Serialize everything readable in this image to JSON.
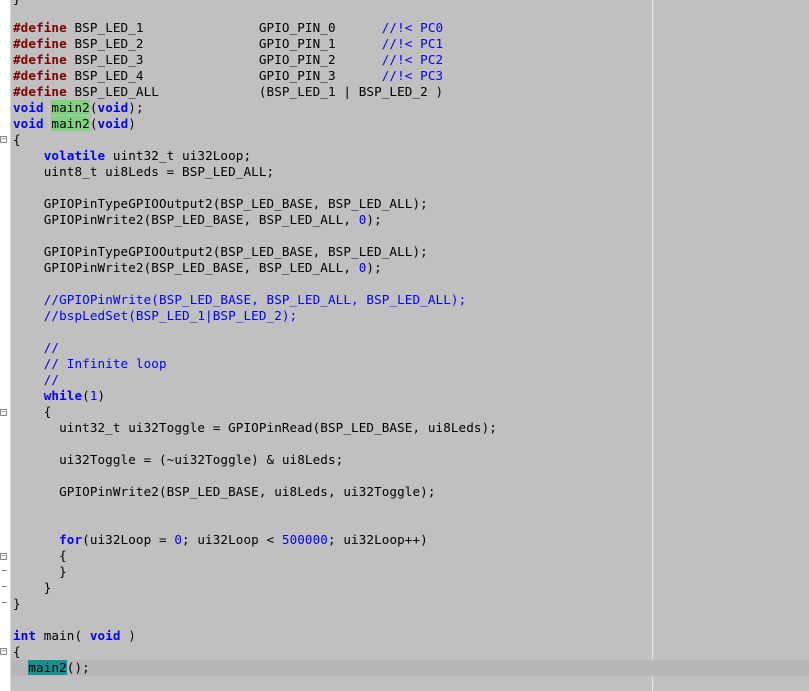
{
  "editor": {
    "top_fragment": "}",
    "lines": {
      "l1": {
        "t1": "#define",
        "t2": " BSP_LED_1               GPIO_PIN_0      ",
        "t3": "//!< PC0"
      },
      "l2": {
        "t1": "#define",
        "t2": " BSP_LED_2               GPIO_PIN_1      ",
        "t3": "//!< PC1"
      },
      "l3": {
        "t1": "#define",
        "t2": " BSP_LED_3               GPIO_PIN_2      ",
        "t3": "//!< PC2"
      },
      "l4": {
        "t1": "#define",
        "t2": " BSP_LED_4               GPIO_PIN_3      ",
        "t3": "//!< PC3"
      },
      "l5": {
        "t1": "#define",
        "t2": " BSP_LED_ALL             (BSP_LED_1 | BSP_LED_2 )"
      },
      "l6": {
        "t1": "void",
        "t2": " ",
        "t3": "main2",
        "t4": "(",
        "t5": "void",
        "t6": ");"
      },
      "l7": {
        "t1": "void",
        "t2": " ",
        "t3": "main2",
        "t4": "(",
        "t5": "void",
        "t6": ")"
      },
      "l8": {
        "t1": "{"
      },
      "l9": {
        "t1": "    ",
        "t2": "volatile",
        "t3": " uint32_t ui32Loop;"
      },
      "l10": {
        "t1": "    uint8_t ui8Leds = BSP_LED_ALL;"
      },
      "l11": {
        "t1": "    GPIOPinTypeGPIOOutput2(BSP_LED_BASE, BSP_LED_ALL);"
      },
      "l12": {
        "t1": "    GPIOPinWrite2(BSP_LED_BASE, BSP_LED_ALL, ",
        "t2": "0",
        "t3": ");"
      },
      "l13": {
        "t1": "    GPIOPinTypeGPIOOutput2(BSP_LED_BASE, BSP_LED_ALL);"
      },
      "l14": {
        "t1": "    GPIOPinWrite2(BSP_LED_BASE, BSP_LED_ALL, ",
        "t2": "0",
        "t3": ");"
      },
      "l15": {
        "t1": "    ",
        "t2": "//GPIOPinWrite(BSP_LED_BASE, BSP_LED_ALL, BSP_LED_ALL);"
      },
      "l16": {
        "t1": "    ",
        "t2": "//bspLedSet(BSP_LED_1|BSP_LED_2);"
      },
      "l17": {
        "t1": "    ",
        "t2": "//"
      },
      "l18": {
        "t1": "    ",
        "t2": "// Infinite loop"
      },
      "l19": {
        "t1": "    ",
        "t2": "//"
      },
      "l20": {
        "t1": "    ",
        "t2": "while",
        "t3": "(",
        "t4": "1",
        "t5": ")"
      },
      "l21": {
        "t1": "    {"
      },
      "l22": {
        "t1": "      uint32_t ui32Toggle = GPIOPinRead(BSP_LED_BASE, ui8Leds);"
      },
      "l23": {
        "t1": "      ui32Toggle = (~ui32Toggle) & ui8Leds;"
      },
      "l24": {
        "t1": "      GPIOPinWrite2(BSP_LED_BASE, ui8Leds, ui32Toggle);"
      },
      "l25": {
        "t1": "      ",
        "t2": "for",
        "t3": "(ui32Loop = ",
        "t4": "0",
        "t5": "; ui32Loop < ",
        "t6": "500000",
        "t7": "; ui32Loop++)"
      },
      "l26": {
        "t1": "      {"
      },
      "l27": {
        "t1": "      }"
      },
      "l28": {
        "t1": "    }"
      },
      "l29": {
        "t1": "}"
      },
      "l30": {
        "t1": "int",
        "t2": " main( ",
        "t3": "void",
        "t4": " )"
      },
      "l31": {
        "t1": "{"
      },
      "l32": {
        "t1": "  ",
        "t2": "main2",
        "t3": "();"
      }
    },
    "colors": {
      "background": "#c0c0c0",
      "preprocessor": "#800000",
      "keyword": "#0000ff",
      "comment": "#0000ff",
      "match_highlight": "#7fd37f",
      "cursor_highlight": "#1a8f8f"
    }
  }
}
